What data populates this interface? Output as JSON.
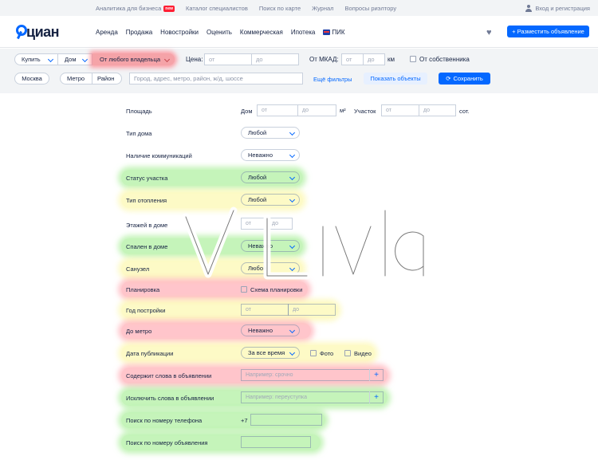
{
  "topbar": {
    "links": [
      "Аналитика для бизнеса",
      "Каталог специалистов",
      "Поиск по карте",
      "Журнал",
      "Вопросы риэлтору"
    ],
    "badge": "new",
    "login": "Вход и регистрация"
  },
  "header": {
    "logo": "циан",
    "nav": [
      "Аренда",
      "Продажа",
      "Новостройки",
      "Оценить",
      "Коммерческая",
      "Ипотека",
      "ПИК"
    ],
    "post_button": "+ Разместить объявление"
  },
  "filters": {
    "deal": "Купить",
    "type": "Дом",
    "owner": "От любого владельца",
    "price_label": "Цена:",
    "price_from": "от",
    "price_to": "до",
    "mkad_label": "От МКАД:",
    "mkad_from": "от",
    "mkad_to": "до",
    "mkad_unit": "км",
    "from_owner": "От собственника",
    "city": "Москва",
    "metro": "Метро",
    "district": "Район",
    "search_placeholder": "Город, адрес, метро, район, ж/д, шоссе",
    "more_filters": "Ещё фильтры",
    "show_button": "Показать объекты",
    "save_button": "Сохранить"
  },
  "form": {
    "area_label": "Площадь",
    "house_label": "Дом",
    "from": "от",
    "to": "до",
    "m2": "м²",
    "plot_label": "Участок",
    "sot": "сот.",
    "house_type_label": "Тип дома",
    "house_type_value": "Любой",
    "utilities_label": "Наличие коммуникаций",
    "utilities_value": "Неважно",
    "plot_status_label": "Статус участка",
    "plot_status_value": "Любой",
    "heating_label": "Тип отопления",
    "heating_value": "Любой",
    "floors_label": "Этажей в доме",
    "bedrooms_label": "Спален в доме",
    "bedrooms_value": "Неважно",
    "bathroom_label": "Санузел",
    "bathroom_value": "Любой",
    "layout_label": "Планировка",
    "layout_checkbox": "Схема планировки",
    "year_label": "Год постройки",
    "metro_label": "До метро",
    "metro_value": "Неважно",
    "publication_label": "Дата публикации",
    "publication_value": "За все время",
    "photo": "Фото",
    "video": "Видео",
    "contains_label": "Содержит слова в объявлении",
    "contains_placeholder": "Например: срочно",
    "exclude_label": "Исключить слова в объявлении",
    "exclude_placeholder": "Например: переуступка",
    "phone_label": "Поиск по номеру телефона",
    "phone_prefix": "+7",
    "ad_number_label": "Поиск по номеру объявления"
  },
  "watermark": "Livla",
  "colors": {
    "accent": "#0468ff",
    "highlight_green": "#96eb82",
    "highlight_yellow": "#fcf6a0",
    "highlight_red": "#ff96a0"
  }
}
